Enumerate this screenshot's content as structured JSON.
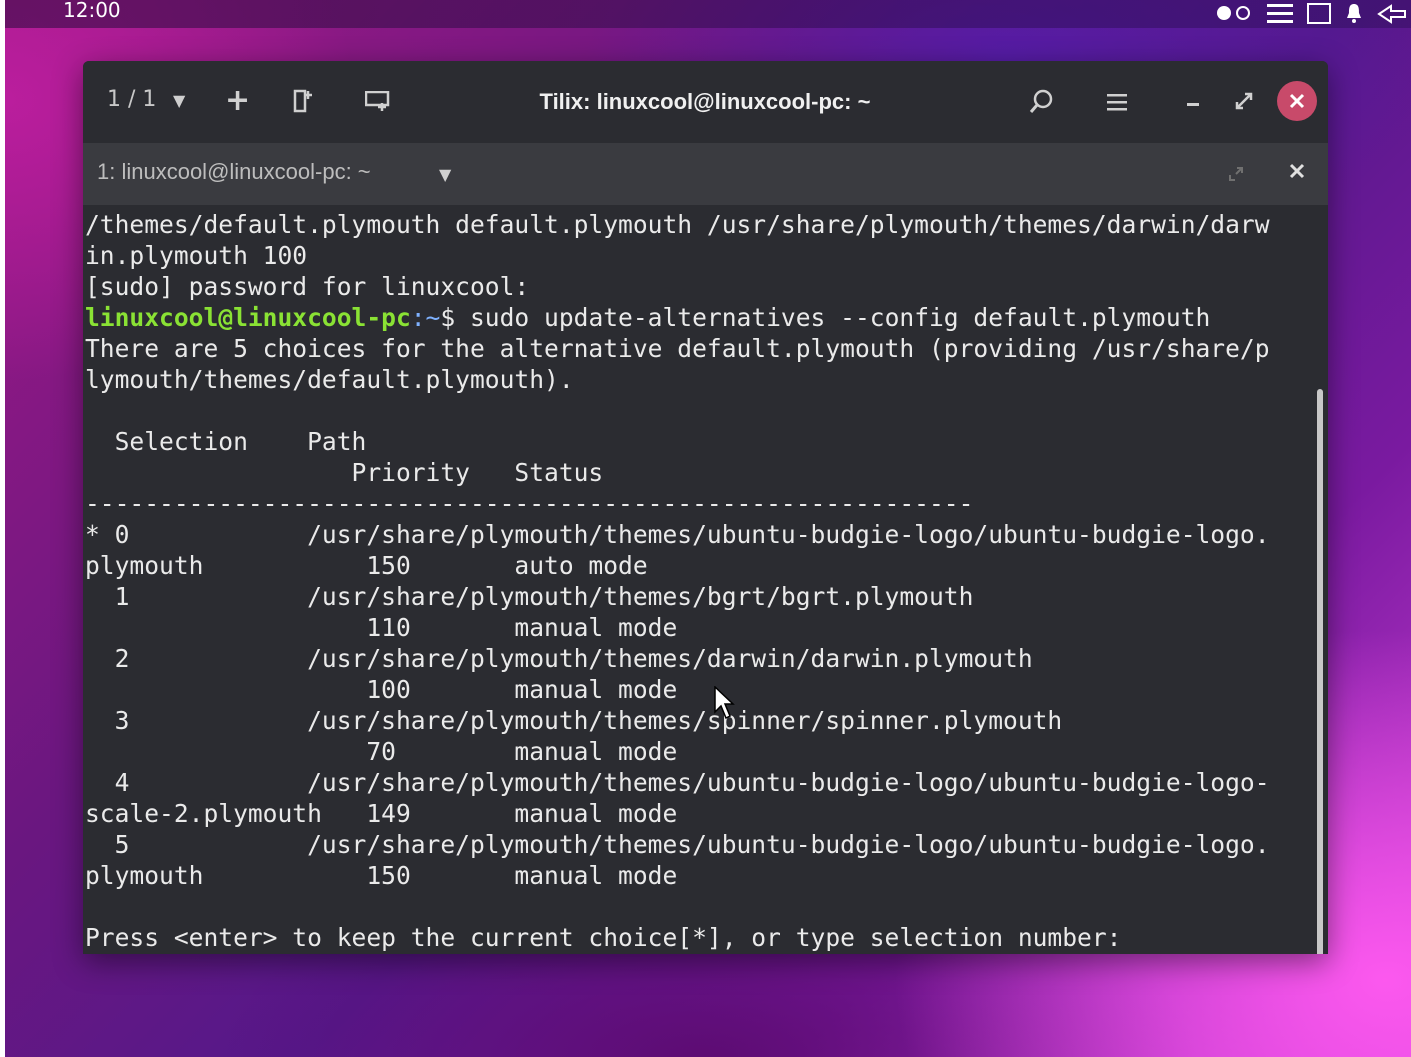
{
  "topbar": {
    "clock": "12:00",
    "tray_icons": [
      "notification-dot-icon",
      "hamburger-icon",
      "window-icon",
      "bell-icon",
      "network-icon"
    ]
  },
  "window": {
    "session_count": "1 / 1",
    "title": "Tilix: linuxcool@linuxcool-pc: ~",
    "close_color": "#c84a6a"
  },
  "tab": {
    "label": "1: linuxcool@linuxcool-pc: ~"
  },
  "terminal": {
    "prompt_user": "linuxcool@linuxcool-pc",
    "prompt_path": ":~",
    "lines_before": [
      "/themes/default.plymouth default.plymouth /usr/share/plymouth/themes/darwin/darw",
      "in.plymouth 100",
      "[sudo] password for linuxcool:"
    ],
    "command": "$ sudo update-alternatives --config default.plymouth",
    "lines_after": [
      "There are 5 choices for the alternative default.plymouth (providing /usr/share/p",
      "lymouth/themes/default.plymouth).",
      "",
      "  Selection    Path",
      "                  Priority   Status",
      "------------------------------------------------------------",
      "* 0            /usr/share/plymouth/themes/ubuntu-budgie-logo/ubuntu-budgie-logo.",
      "plymouth           150       auto mode",
      "  1            /usr/share/plymouth/themes/bgrt/bgrt.plymouth",
      "                   110       manual mode",
      "  2            /usr/share/plymouth/themes/darwin/darwin.plymouth",
      "                   100       manual mode",
      "  3            /usr/share/plymouth/themes/spinner/spinner.plymouth",
      "                   70        manual mode",
      "  4            /usr/share/plymouth/themes/ubuntu-budgie-logo/ubuntu-budgie-logo-",
      "scale-2.plymouth   149       manual mode",
      "  5            /usr/share/plymouth/themes/ubuntu-budgie-logo/ubuntu-budgie-logo.",
      "plymouth           150       manual mode",
      "",
      "Press <enter> to keep the current choice[*], or type selection number: "
    ]
  }
}
